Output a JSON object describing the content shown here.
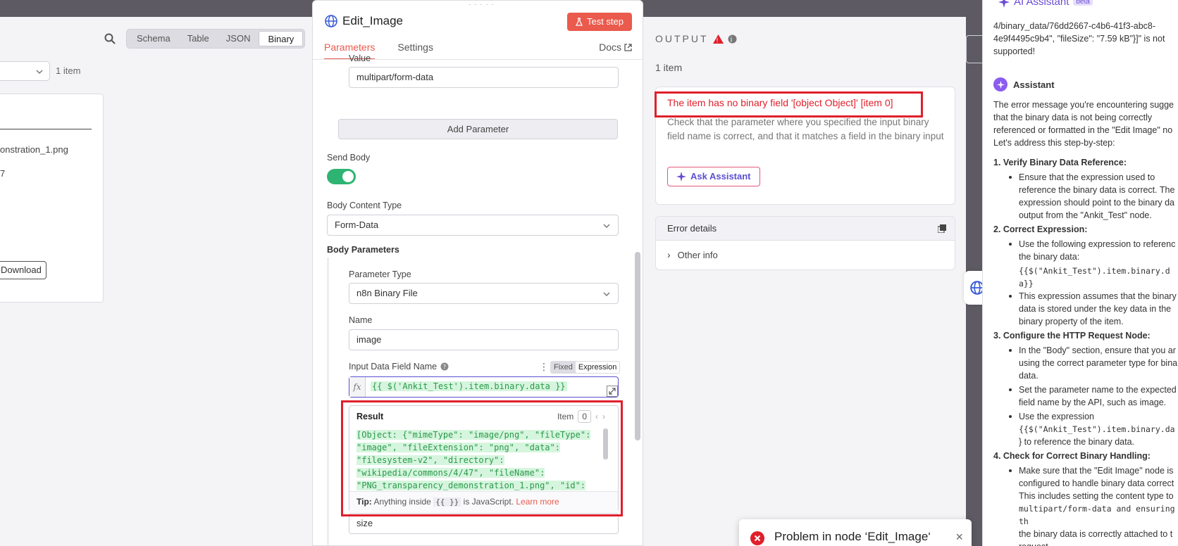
{
  "input_panel": {
    "view_tabs": [
      "Schema",
      "Table",
      "JSON",
      "Binary"
    ],
    "active_view": "Binary",
    "item_count": "1 item",
    "file_name_partial": "onstration_1.png",
    "file_size_partial": "7",
    "download_label": "Download"
  },
  "node": {
    "title": "Edit_Image",
    "test_step_label": "Test step",
    "tabs": [
      "Parameters",
      "Settings"
    ],
    "docs_label": "Docs",
    "value_label": "Value",
    "value_field": "multipart/form-data",
    "add_parameter_label": "Add Parameter",
    "send_body_label": "Send Body",
    "send_body_enabled": true,
    "body_content_type_label": "Body Content Type",
    "body_content_type_value": "Form-Data",
    "body_parameters_label": "Body Parameters",
    "parameter_type_label": "Parameter Type",
    "parameter_type_value": "n8n Binary File",
    "name_label": "Name",
    "name_value": "image",
    "input_field_label": "Input Data Field Name",
    "mode_fixed": "Fixed",
    "mode_expression": "Expression",
    "expression_value": "{{ $('Ankit_Test').item.binary.data }}",
    "next_field_value": "size",
    "result": {
      "title": "Result",
      "item_label": "Item",
      "item_index": "0",
      "lines": [
        "[Object: {\"mimeType\": \"image/png\", \"fileType\":",
        "\"image\", \"fileExtension\": \"png\", \"data\":",
        "\"filesystem-v2\", \"directory\":",
        "\"wikipedia/commons/4/47\", \"fileName\":",
        "\"PNG_transparency_demonstration_1.png\", \"id\":"
      ],
      "tip_label": "Tip:",
      "tip_text": "Anything inside",
      "tip_chip": "{{ }}",
      "tip_text2": "is JavaScript.",
      "tip_link": "Learn more"
    }
  },
  "output": {
    "title": "OUTPUT",
    "item_count": "1 item",
    "error_message": "The item has no binary field '[object Object]' [item 0]",
    "error_description": "Check that the parameter where you specified the input binary field name is correct, and that it matches a field in the binary input",
    "ask_assistant_label": "Ask Assistant",
    "error_details_label": "Error details",
    "other_info_label": "Other info"
  },
  "assistant": {
    "header_title": "AI Assistant",
    "beta": "beta",
    "prev_msg_lines": [
      "4/binary_data/76dd2667-c4b6-41f3-abc8-",
      "4e9f4495c9b4\", \"fileSize\": \"7.59 kB\"}]\" is not",
      "supported!"
    ],
    "name": "Assistant",
    "intro_lines": [
      "The error message you're encountering sugge",
      "that the binary data is not being correctly",
      "referenced or formatted in the \"Edit Image\" no",
      "Let's address this step-by-step:"
    ],
    "steps": [
      {
        "title": "1. Verify Binary Data Reference:",
        "bullets": [
          [
            "Ensure that the expression used to",
            "reference the binary data is correct. The",
            "expression should point to the binary da",
            "output from the \"Ankit_Test\" node."
          ]
        ]
      },
      {
        "title": "2. Correct Expression:",
        "bullets": [
          [
            "Use the following expression to referenc",
            "the binary data:"
          ]
        ],
        "code": [
          "{{$(\"Ankit_Test\").item.binary.d",
          "a}}"
        ],
        "bullets2": [
          [
            "This expression assumes that the binary",
            "data is stored under the key data in the",
            "binary property of the item."
          ]
        ]
      },
      {
        "title": "3. Configure the HTTP Request Node:",
        "bullets": [
          [
            "In the \"Body\" section, ensure that you ar",
            "using the correct parameter type for bina",
            "data."
          ],
          [
            "Set the parameter name to the expected",
            "field name by the API, such as image."
          ],
          [
            "Use the expression",
            "{{$(\"Ankit_Test\").item.binary.da",
            "} to reference the binary data."
          ]
        ]
      },
      {
        "title": "4. Check for Correct Binary Handling:",
        "bullets": [
          [
            "Make sure that the \"Edit Image\" node is",
            "configured to handle binary data correct",
            "This includes setting the content type to",
            "multipart/form-data and ensuring th",
            "the binary data is correctly attached to t",
            "request."
          ]
        ]
      }
    ]
  },
  "toast": {
    "message": "Problem in node ‘Edit_Image‘"
  },
  "colors": {
    "accent": "#ea5a4d",
    "error": "#e01f2b",
    "success": "#2db472",
    "assistant": "#6a4ad6"
  }
}
